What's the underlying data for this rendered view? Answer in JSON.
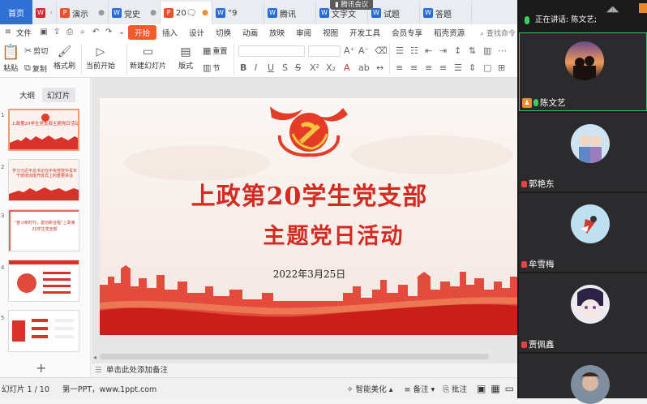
{
  "tabbar": {
    "home": "首页",
    "tabs": [
      {
        "icon": "wps-red",
        "label": "",
        "modified": false
      },
      {
        "icon": "P",
        "label": "演示",
        "modified": false
      },
      {
        "icon": "W",
        "label": "党史",
        "modified": false
      },
      {
        "icon": "P",
        "label": "20🗨",
        "modified": true
      },
      {
        "icon": "W",
        "label": "“9",
        "modified": false
      },
      {
        "icon": "W",
        "label": "腾讯",
        "modified": false
      },
      {
        "icon": "W",
        "label": "文字文",
        "modified": false
      },
      {
        "icon": "W",
        "label": "试题",
        "modified": false
      },
      {
        "icon": "W",
        "label": "答题",
        "modified": false
      }
    ]
  },
  "menubar": {
    "file": "文件",
    "items": [
      "开始",
      "插入",
      "设计",
      "切换",
      "动画",
      "放映",
      "审阅",
      "视图",
      "开发工具",
      "会员专享",
      "稻壳资源"
    ],
    "active": "开始",
    "search": "查找命令"
  },
  "ribbon": {
    "paste": "粘贴",
    "cut": "剪切",
    "copy": "复制",
    "format_painter": "格式刷",
    "play_from_current": "当前开始",
    "new_slide": "新建幻灯片",
    "layout": "版式",
    "section": "节",
    "reset": "重置",
    "font_size_a": "A⁺",
    "font_size_b": "A⁻"
  },
  "leftpanel": {
    "tab_outline": "大纲",
    "tab_slides": "幻灯片",
    "thumbs": [
      {
        "num": "1",
        "text": "上政第20学生党支部主题党日活动"
      },
      {
        "num": "2",
        "text": "学习习近平总书记在中央党校中青年干部培训班开班式上的重要讲话"
      },
      {
        "num": "3",
        "text": "“奋斗新时代，建功新征程”上政第20学生党支部"
      },
      {
        "num": "4",
        "text": "目录"
      },
      {
        "num": "5",
        "text": "目录"
      }
    ]
  },
  "slide": {
    "title": "上政第20学生党支部",
    "subtitle": "主题党日活动",
    "date": "2022年3月25日"
  },
  "notes": {
    "placeholder": "单击此处添加备注"
  },
  "statusbar": {
    "slide_counter": "幻灯片 1 / 10",
    "theme": "第一PPT，www.1ppt.com",
    "smart_beautify": "智能美化",
    "notes": "备注",
    "annotate": "批注"
  },
  "meeting": {
    "badge": "腾讯会议",
    "speaking": "正在讲话: 陈文艺;",
    "participants": [
      {
        "name": "陈文艺",
        "active": true,
        "mic": "on"
      },
      {
        "name": "郭艳东",
        "active": false,
        "mic": "off"
      },
      {
        "name": "牟雪梅",
        "active": false,
        "mic": "off"
      },
      {
        "name": "贾佩鑫",
        "active": false,
        "mic": "off"
      },
      {
        "name": "",
        "active": false,
        "mic": "off"
      }
    ]
  },
  "colors": {
    "accent": "#f25a2a",
    "party_red": "#d42a20",
    "meeting_bg": "#1b1b1c",
    "active_speaker": "#3bc46d"
  }
}
